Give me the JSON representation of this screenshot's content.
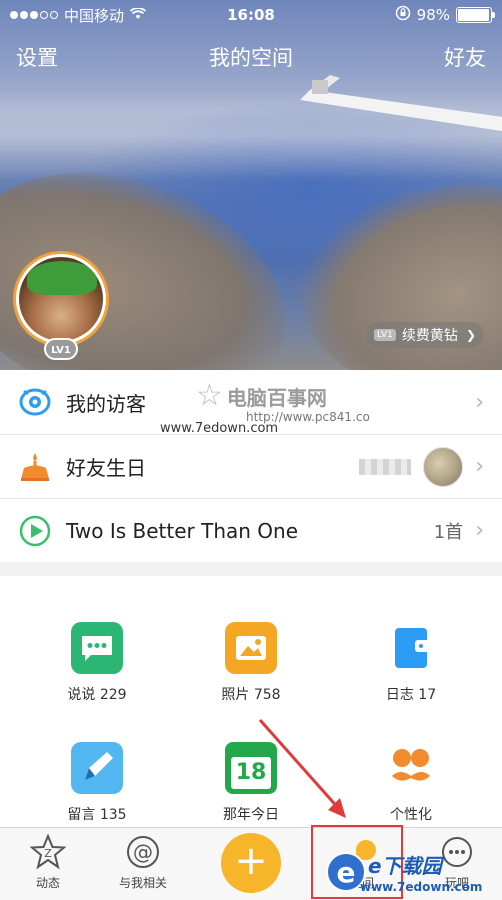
{
  "status_bar": {
    "carrier": "中国移动",
    "time": "16:08",
    "battery_percent": "98%",
    "battery_level": 0.98
  },
  "nav": {
    "left": "设置",
    "title": "我的空间",
    "right": "好友"
  },
  "profile": {
    "level_badge": "LV1",
    "vip_level": "LV1",
    "vip_action": "续费黄钻"
  },
  "list": [
    {
      "icon": "eye-icon",
      "label": "我的访客",
      "right_text": ""
    },
    {
      "icon": "cake-icon",
      "label": "好友生日",
      "right_text": ""
    },
    {
      "icon": "play-icon",
      "label": "Two Is Better Than One",
      "right_text": "1首"
    }
  ],
  "grid": [
    {
      "icon": "chat-bubble-icon",
      "label": "说说 229",
      "color": "#2bb673"
    },
    {
      "icon": "photo-icon",
      "label": "照片 758",
      "color": "#f5a623"
    },
    {
      "icon": "diary-icon",
      "label": "日志 17",
      "color": "#2d9cf5"
    },
    {
      "icon": "pen-icon",
      "label": "留言 135",
      "color": "#52b6f0"
    },
    {
      "icon": "calendar-icon",
      "label": "那年今日",
      "color": "#22a84a"
    },
    {
      "icon": "mustache-icon",
      "label": "个性化",
      "color": "#f28a2e"
    }
  ],
  "calendar_day": "18",
  "tabs": [
    {
      "icon": "star-z-icon",
      "label": "动态"
    },
    {
      "icon": "at-icon",
      "label": "与我相关"
    },
    {
      "icon": "plus-icon",
      "label": ""
    },
    {
      "icon": "space-icon",
      "label": "空间"
    },
    {
      "icon": "more-icon",
      "label": "玩吧"
    }
  ],
  "watermarks": {
    "site1": "电脑百事网",
    "site1_url": "http://www.pc841.co",
    "site2": "www.7edown.com",
    "site3": "e下载园",
    "site3_url": "www.7edown.com"
  },
  "colors": {
    "accent_orange": "#f7b52c",
    "highlight_red": "#e23a3a"
  }
}
